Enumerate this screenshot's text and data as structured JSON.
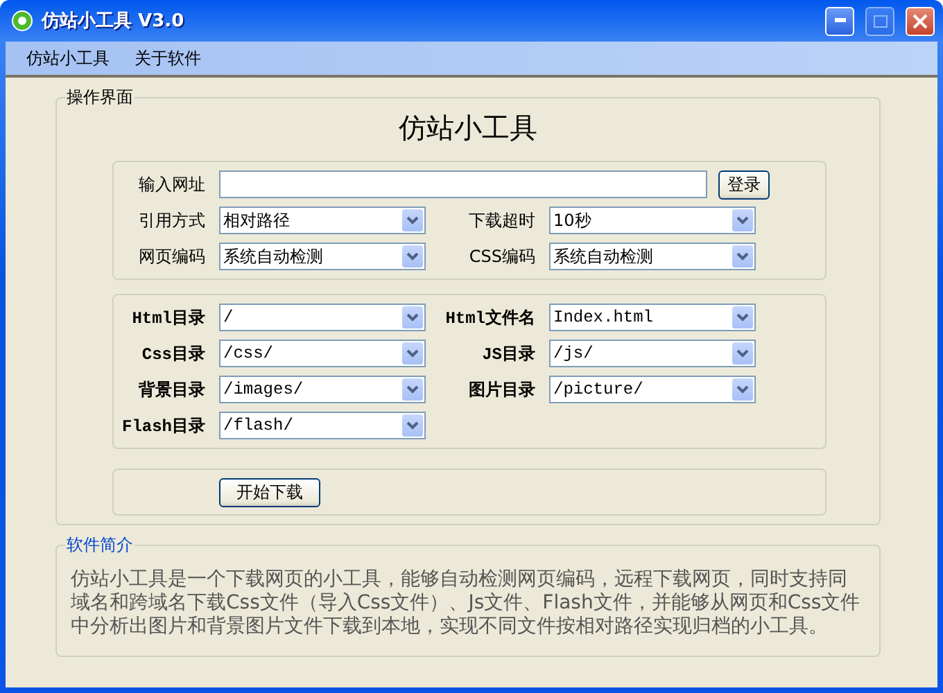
{
  "window": {
    "title": "仿站小工具 V3.0"
  },
  "menu": [
    "仿站小工具",
    "关于软件"
  ],
  "operation": {
    "legend": "操作界面",
    "heading": "仿站小工具",
    "url": {
      "label": "输入网址"
    },
    "login_button": "登录",
    "settings": [
      [
        {
          "label": "引用方式",
          "value": "相对路径"
        },
        {
          "label": "下载超时",
          "value": "10秒"
        }
      ],
      [
        {
          "label": "网页编码",
          "value": "系统自动检测"
        },
        {
          "label": "CSS编码",
          "value": "系统自动检测"
        }
      ]
    ],
    "directories": [
      [
        {
          "label": "Html目录",
          "value": "/"
        },
        {
          "label": "Html文件名",
          "value": "Index.html"
        }
      ],
      [
        {
          "label": "Css目录",
          "value": "/css/"
        },
        {
          "label": "JS目录",
          "value": "/js/"
        }
      ],
      [
        {
          "label": "背景目录",
          "value": "/images/"
        },
        {
          "label": "图片目录",
          "value": "/picture/"
        }
      ],
      [
        {
          "label": "Flash目录",
          "value": "/flash/"
        }
      ]
    ],
    "start_button": "开始下载"
  },
  "about": {
    "legend": "软件简介",
    "text": "仿站小工具是一个下载网页的小工具，能够自动检测网页编码，远程下载网页，同时支持同域名和跨域名下载Css文件（导入Css文件）、Js文件、Flash文件，并能够从网页和Css文件中分析出图片和背景图片文件下载到本地，实现不同文件按相对路径实现归档的小工具。"
  }
}
